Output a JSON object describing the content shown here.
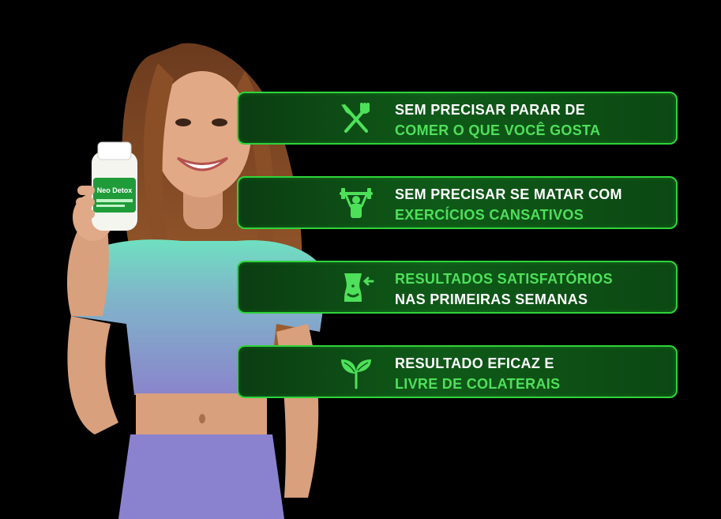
{
  "product": {
    "label": "Neo Detox"
  },
  "colors": {
    "background": "#000000",
    "card_border": "#2fd43a",
    "card_fill": "#0f5a18",
    "accent_text": "#4ee05a",
    "primary_text": "#ffffff"
  },
  "benefits": [
    {
      "icon": "fork-knife-icon",
      "line1": "SEM PRECISAR PARAR DE",
      "line2": "COMER O QUE VOCÊ GOSTA",
      "line1_color": "white",
      "line2_color": "green"
    },
    {
      "icon": "weightlifting-icon",
      "line1": "SEM PRECISAR SE MATAR COM",
      "line2": "EXERCÍCIOS CANSATIVOS",
      "line1_color": "white",
      "line2_color": "green"
    },
    {
      "icon": "waist-slimming-icon",
      "line1": "RESULTADOS SATISFATÓRIOS",
      "line2": "NAS PRIMEIRAS SEMANAS",
      "line1_color": "green",
      "line2_color": "white"
    },
    {
      "icon": "leaf-sprout-icon",
      "line1": "RESULTADO EFICAZ E",
      "line2": "LIVRE DE COLATERAIS",
      "line1_color": "white",
      "line2_color": "green"
    }
  ]
}
